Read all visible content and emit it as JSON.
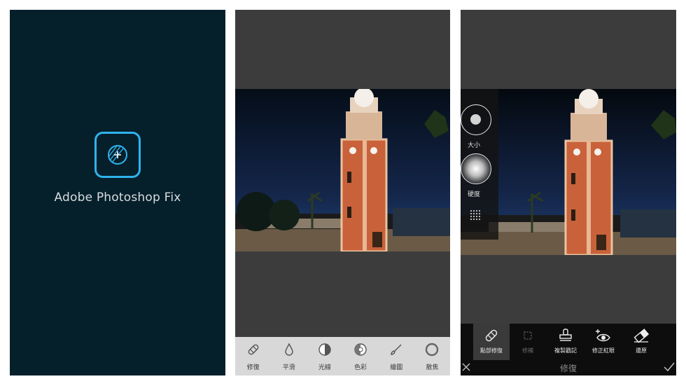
{
  "splash": {
    "app_name": "Adobe Photoshop Fix",
    "icon": "photoshop-fix-logo-icon",
    "colors": {
      "background": "#05202b",
      "accent": "#2fb3ef"
    }
  },
  "editor": {
    "tools": [
      {
        "label": "修復",
        "icon": "bandage-icon"
      },
      {
        "label": "平滑",
        "icon": "droplet-icon"
      },
      {
        "label": "光線",
        "icon": "half-circle-icon"
      },
      {
        "label": "色彩",
        "icon": "color-circle-icon"
      },
      {
        "label": "繪圖",
        "icon": "brush-icon"
      },
      {
        "label": "散焦",
        "icon": "ring-icon"
      }
    ]
  },
  "repair": {
    "brush_size_label": "大小",
    "brush_hardness_label": "硬度",
    "tools": [
      {
        "label": "點部修復",
        "icon": "bandage-icon",
        "active": true
      },
      {
        "label": "修補",
        "icon": "patch-icon",
        "disabled": true
      },
      {
        "label": "複製戳記",
        "icon": "stamp-icon"
      },
      {
        "label": "修正紅眼",
        "icon": "red-eye-icon"
      },
      {
        "label": "還原",
        "icon": "eraser-icon"
      }
    ],
    "title": "修復"
  }
}
